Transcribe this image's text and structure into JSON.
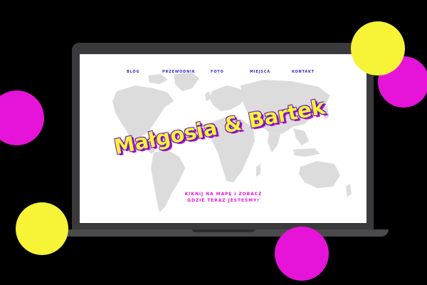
{
  "colors": {
    "background": "#000000",
    "nav": "#2b2ccf",
    "accent_magenta": "#e514d8",
    "accent_yellow": "#f7f336",
    "map_land": "#dcdcdc",
    "laptop": "#3a3a3c"
  },
  "nav": {
    "items": [
      {
        "label": "BLOG"
      },
      {
        "label": "PRZEWODNIK"
      },
      {
        "label": "FOTO"
      },
      {
        "label": "MIEJSCA"
      },
      {
        "label": "KONTAKT"
      }
    ]
  },
  "hero": {
    "title": "Małgosia & Bartek",
    "cta_line1": "KIKNIJ NA MAPĘ I ZOBACZ",
    "cta_line2": "GDZIE TERAZ JESTEŚMY!"
  },
  "decor": {
    "icons": [
      "world-map",
      "laptop",
      "sticker-dot-yellow",
      "sticker-dot-magenta"
    ]
  }
}
